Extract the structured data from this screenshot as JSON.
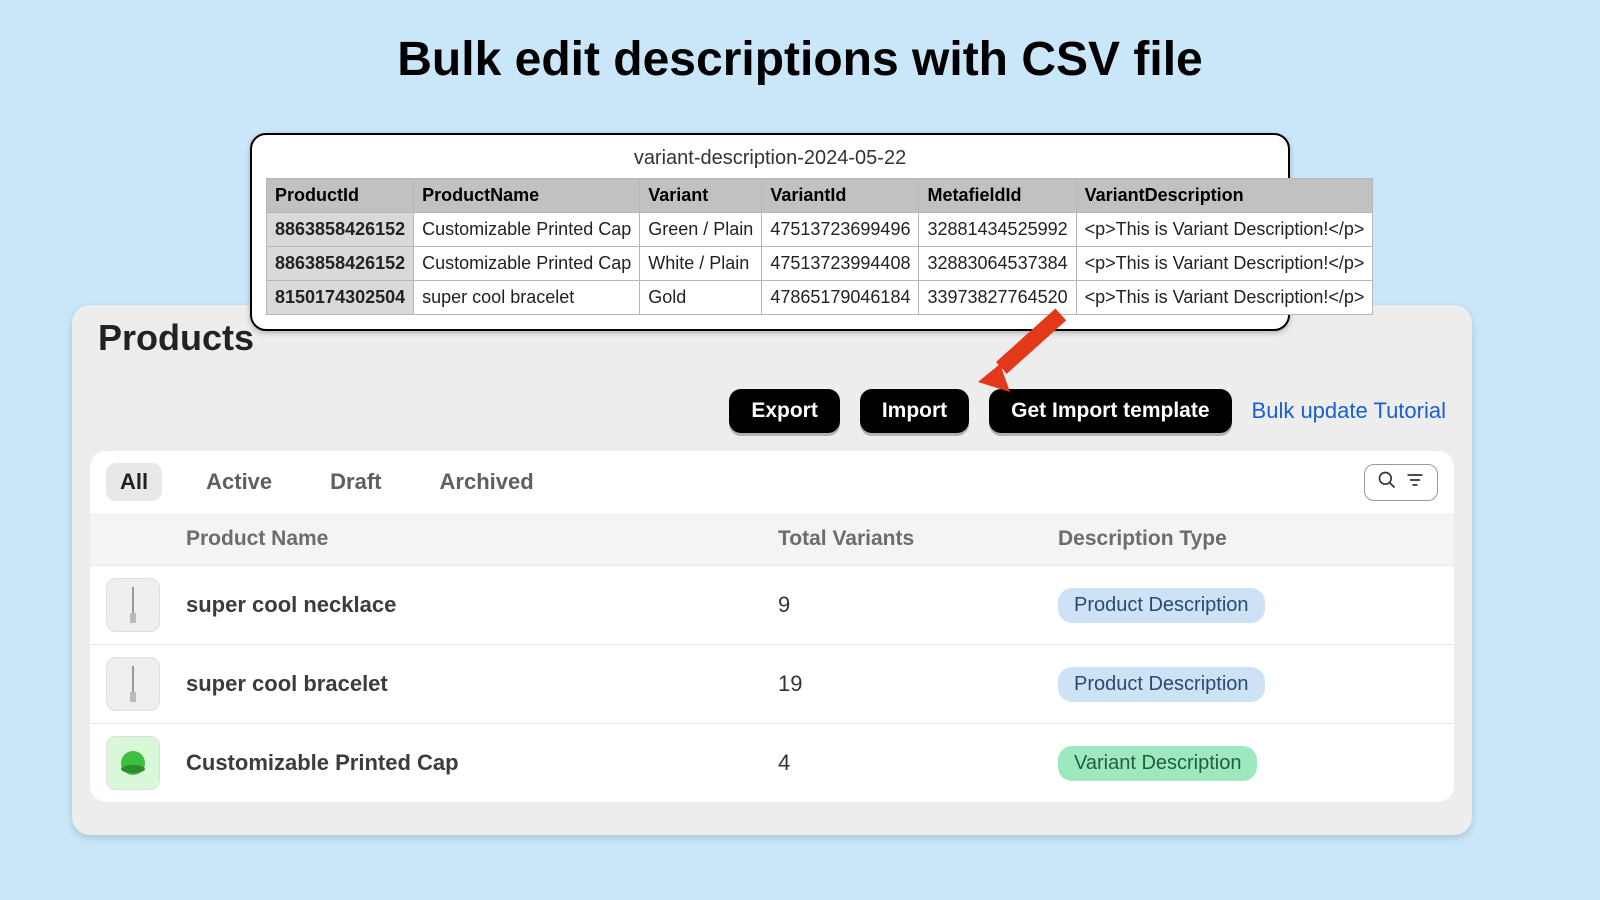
{
  "page_title": "Bulk edit descriptions with CSV file",
  "csv": {
    "filename": "variant-description-2024-05-22",
    "headers": [
      "ProductId",
      "ProductName",
      "Variant",
      "VariantId",
      "MetafieldId",
      "VariantDescription"
    ],
    "rows": [
      [
        "8863858426152",
        "Customizable Printed Cap",
        "Green / Plain",
        "47513723699496",
        "32881434525992",
        "<p>This is Variant Description!</p>"
      ],
      [
        "8863858426152",
        "Customizable Printed Cap",
        "White / Plain",
        "47513723994408",
        "32883064537384",
        "<p>This is Variant Description!</p>"
      ],
      [
        "8150174302504",
        "super cool bracelet",
        "Gold",
        "47865179046184",
        "33973827764520",
        "<p>This is Variant Description!</p>"
      ]
    ]
  },
  "products_heading": "Products",
  "actions": {
    "export": "Export",
    "import": "Import",
    "template": "Get Import template",
    "tutorial": "Bulk update Tutorial"
  },
  "tabs": [
    "All",
    "Active",
    "Draft",
    "Archived"
  ],
  "active_tab": "All",
  "list_headers": {
    "name": "Product Name",
    "variants": "Total Variants",
    "desc": "Description Type"
  },
  "products": [
    {
      "name": "super cool necklace",
      "variants": "9",
      "desc": "Product Description",
      "badge": "blue",
      "thumb": "plain"
    },
    {
      "name": "super cool bracelet",
      "variants": "19",
      "desc": "Product Description",
      "badge": "blue",
      "thumb": "plain"
    },
    {
      "name": "Customizable Printed Cap",
      "variants": "4",
      "desc": "Variant Description",
      "badge": "green",
      "thumb": "green"
    }
  ],
  "colors": {
    "page_bg": "#cae7fa",
    "card_bg": "#ededed",
    "badge_blue": "#cde3f5",
    "badge_green": "#9ee8c0",
    "link": "#1a5fd6",
    "arrow": "#e3391b"
  }
}
